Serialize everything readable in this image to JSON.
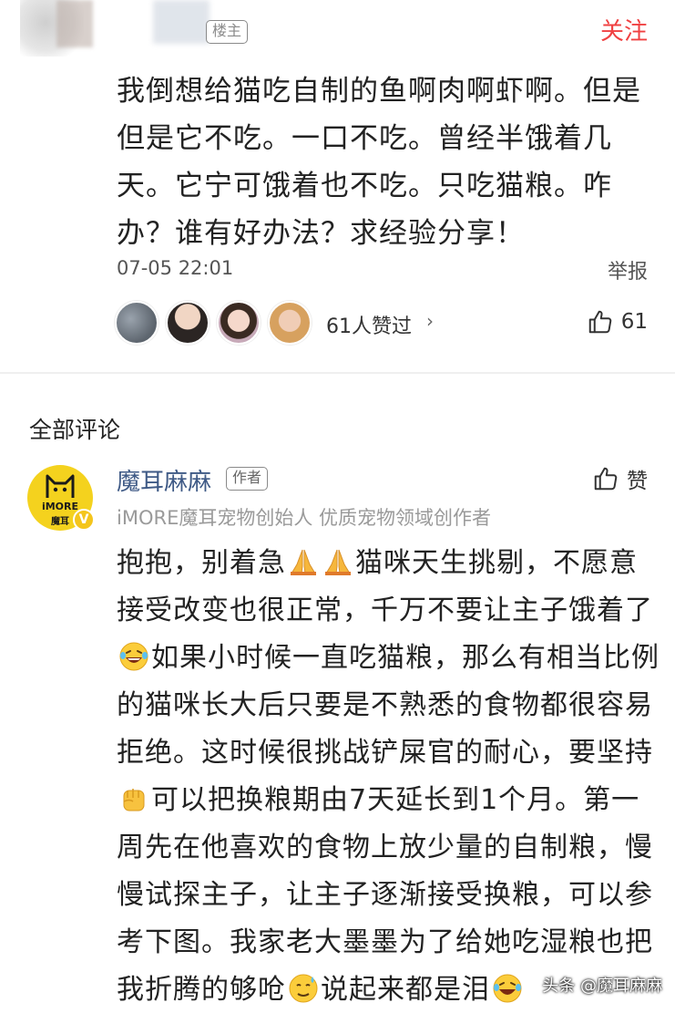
{
  "post": {
    "follow_label": "关注",
    "badge": "楼主",
    "text": "我倒想给猫吃自制的鱼啊肉啊虾啊。但是但是它不吃。一口不吃。曾经半饿着几天。它宁可饿着也不吃。只吃猫粮。咋办？谁有好办法？求经验分享！",
    "time": "07-05 22:01",
    "report_label": "举报",
    "likers_text": "61人赞过",
    "likers_chevron": "›",
    "like_count": "61"
  },
  "comments_section": {
    "title": "全部评论"
  },
  "comment": {
    "author": "魔耳麻麻",
    "author_badge": "作者",
    "avatar_brand": "iMORE",
    "avatar_brand2": "魔耳",
    "verified_mark": "V",
    "subtitle": "iMORE魔耳宠物创始人 优质宠物领域创作者",
    "like_label": "赞",
    "text_part1": "抱抱，别着急",
    "text_part2": "猫咪天生挑剔，不愿意接受改变也很正常，千万不要让主子饿着了",
    "text_part3": "如果小时候一直吃猫粮，那么有相当比例的猫咪长大后只要是不熟悉的食物都很容易拒绝。这时候很挑战铲屎官的耐心，要坚持",
    "text_part4": "可以把换粮期由7天延长到1个月。第一周先在他喜欢的食物上放少量的自制粮，慢慢试探主子，让主子逐渐接受换粮，可以参考下图。我家老大墨墨为了给她吃湿粮也把我折腾的够呛",
    "text_part5": "说起来都是泪",
    "emojis": [
      "pray-emoji",
      "pray-emoji",
      "laugh-cry-emoji",
      "fist-emoji",
      "sweat-emoji",
      "laugh-cry-emoji"
    ]
  },
  "watermark": "头条 @魔耳麻麻",
  "colors": {
    "accent_red": "#f04142",
    "name_blue": "#3f5a86",
    "avatar_yellow": "#f4d21e",
    "meta_gray": "#9a9a9a"
  }
}
